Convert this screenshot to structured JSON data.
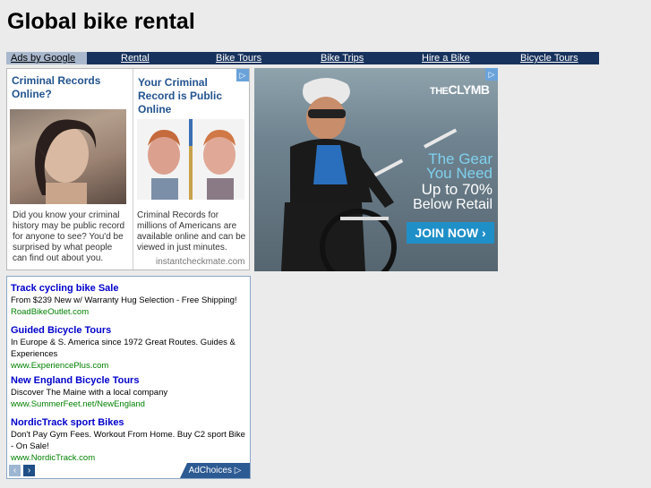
{
  "site": {
    "title": "Global bike rental"
  },
  "nav": {
    "ads_label": "Ads by Google",
    "links": [
      "Rental",
      "Bike Tours",
      "Bike Trips",
      "Hire a Bike",
      "Bicycle Tours"
    ]
  },
  "ad_criminal": {
    "left_headline": "Criminal Records Online?",
    "left_body": "Did you know your criminal history may be public record for anyone to see? You'd be surprised by what people can find out about you.",
    "right_headline": "Your Criminal Record is Public Online",
    "right_body": "Criminal Records for millions of Americans are available online and can be viewed in just minutes.",
    "site": "instantcheckmate.com",
    "adchoice_glyph": "▷"
  },
  "ad_clymb": {
    "brand_prefix": "THE",
    "brand_name": "CLYMB",
    "tagline_1": "The Gear",
    "tagline_2": "You Need",
    "tagline_3": "Up to 70%",
    "tagline_4": "Below Retail",
    "cta": "JOIN NOW ›",
    "adchoice_glyph": "▷"
  },
  "text_ads": [
    {
      "title": "Track cycling bike Sale",
      "desc": "From $239 New w/ Warranty Hug Selection - Free Shipping!",
      "url": "RoadBikeOutlet.com"
    },
    {
      "title": "Guided Bicycle Tours",
      "desc": "In Europe & S. America since 1972 Great Routes. Guides & Experiences",
      "url": "www.ExperiencePlus.com"
    },
    {
      "title": "New England Bicycle Tours",
      "desc": "Discover The Maine with a local company",
      "url": "www.SummerFeet.net/NewEngland"
    },
    {
      "title": "NordicTrack sport Bikes",
      "desc": "Don't Pay Gym Fees. Workout From Home. Buy C2 sport Bike - On Sale!",
      "url": "www.NordicTrack.com"
    }
  ],
  "text_ads_footer": {
    "prev": "‹",
    "next": "›",
    "adchoices": "AdChoices ▷"
  }
}
